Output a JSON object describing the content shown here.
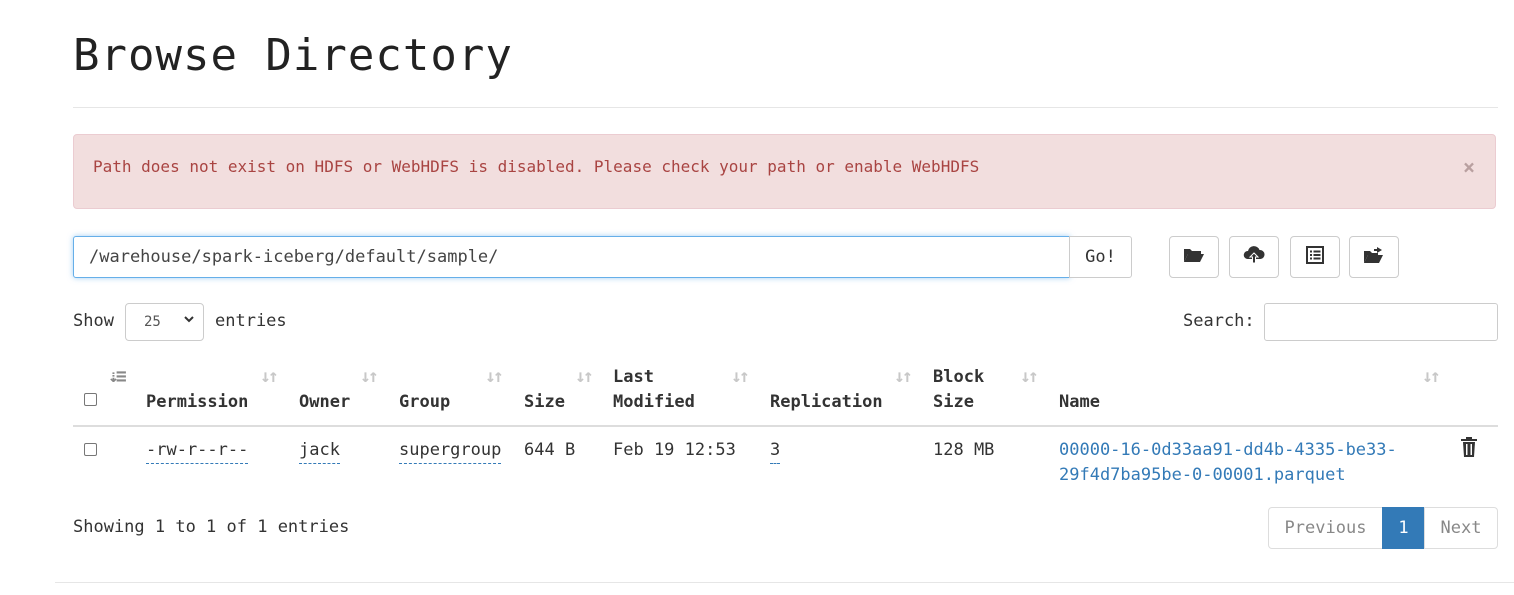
{
  "page": {
    "title": "Browse Directory"
  },
  "alert": {
    "message": "Path does not exist on HDFS or WebHDFS is disabled. Please check your path or enable WebHDFS",
    "close_symbol": "×"
  },
  "path_bar": {
    "value": "/warehouse/spark-iceberg/default/sample/",
    "go_label": "Go!"
  },
  "toolbar": {
    "icons": [
      "folder-open-icon",
      "cloud-upload-icon",
      "list-icon",
      "folder-move-icon"
    ]
  },
  "length_control": {
    "show_label": "Show",
    "selected": "25",
    "entries_label": "entries"
  },
  "search": {
    "label": "Search:"
  },
  "table": {
    "columns": {
      "permission": "Permission",
      "owner": "Owner",
      "group": "Group",
      "size": "Size",
      "last_modified_1": "Last",
      "last_modified_2": "Modified",
      "replication": "Replication",
      "block_size_1": "Block",
      "block_size_2": "Size",
      "name": "Name"
    },
    "rows": [
      {
        "permission": "-rw-r--r--",
        "owner": "jack",
        "group": "supergroup",
        "size": "644 B",
        "last_modified": "Feb 19 12:53",
        "replication": "3",
        "block_size": "128 MB",
        "name_line1": "00000-16-0d33aa91-dd4b-4335-be33-",
        "name_line2": "29f4d7ba95be-0-00001.parquet"
      }
    ]
  },
  "footer": {
    "info": "Showing 1 to 1 of 1 entries"
  },
  "pagination": {
    "previous": "Previous",
    "current": "1",
    "next": "Next",
    "active_color": "#337ab7"
  },
  "colors": {
    "link": "#337ab7",
    "alert_bg": "#f2dede",
    "alert_text": "#a94442"
  }
}
